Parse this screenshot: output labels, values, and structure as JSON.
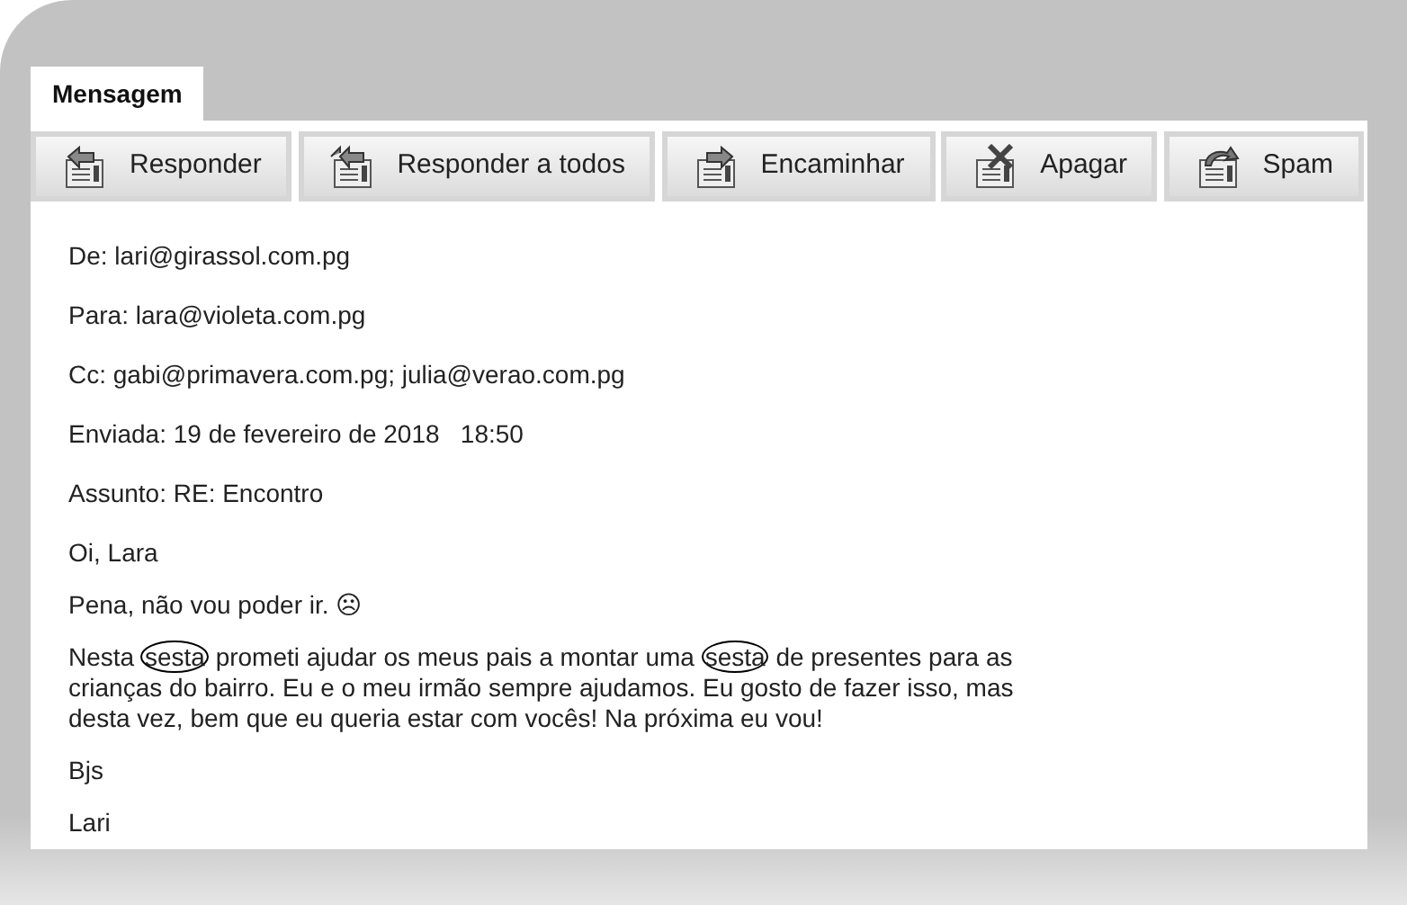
{
  "tabs": [
    {
      "label": "Mensagem",
      "selected": true
    }
  ],
  "toolbar": [
    {
      "label": "Responder",
      "kind": "reply"
    },
    {
      "label": "Responder a todos",
      "kind": "reply_all"
    },
    {
      "label": "Encaminhar",
      "kind": "forward"
    },
    {
      "label": "Apagar",
      "kind": "delete"
    },
    {
      "label": "Spam",
      "kind": "spam"
    }
  ],
  "headers": [
    "De: lari@girassol.com.pg",
    "Para: lara@violeta.com.pg",
    "Cc: gabi@primavera.com.pg; julia@verao.com.pg",
    "Enviada: 19 de fevereiro de 2018   18:50",
    "Assunto: RE: Encontro"
  ],
  "body": [
    {
      "segments": [
        {
          "text": "Oi, Lara",
          "circled": false
        }
      ]
    },
    {
      "segments": [
        {
          "text": "Pena, não vou poder ir. ☹",
          "circled": false
        }
      ]
    },
    {
      "segments": [
        {
          "text": "Nesta ",
          "circled": false
        },
        {
          "text": "sesta",
          "circled": true
        },
        {
          "text": " prometi ajudar os meus pais a montar uma ",
          "circled": false
        },
        {
          "text": "sesta",
          "circled": true
        },
        {
          "text": " de presentes para as crianças do bairro. Eu e o meu irmão sempre ajudamos. Eu gosto de fazer isso, mas desta vez, bem que eu queria estar com vocês! Na próxima eu vou!",
          "circled": false
        }
      ]
    },
    {
      "segments": [
        {
          "text": "Bjs",
          "circled": false
        }
      ]
    },
    {
      "segments": [
        {
          "text": "Lari",
          "circled": false
        }
      ]
    }
  ]
}
